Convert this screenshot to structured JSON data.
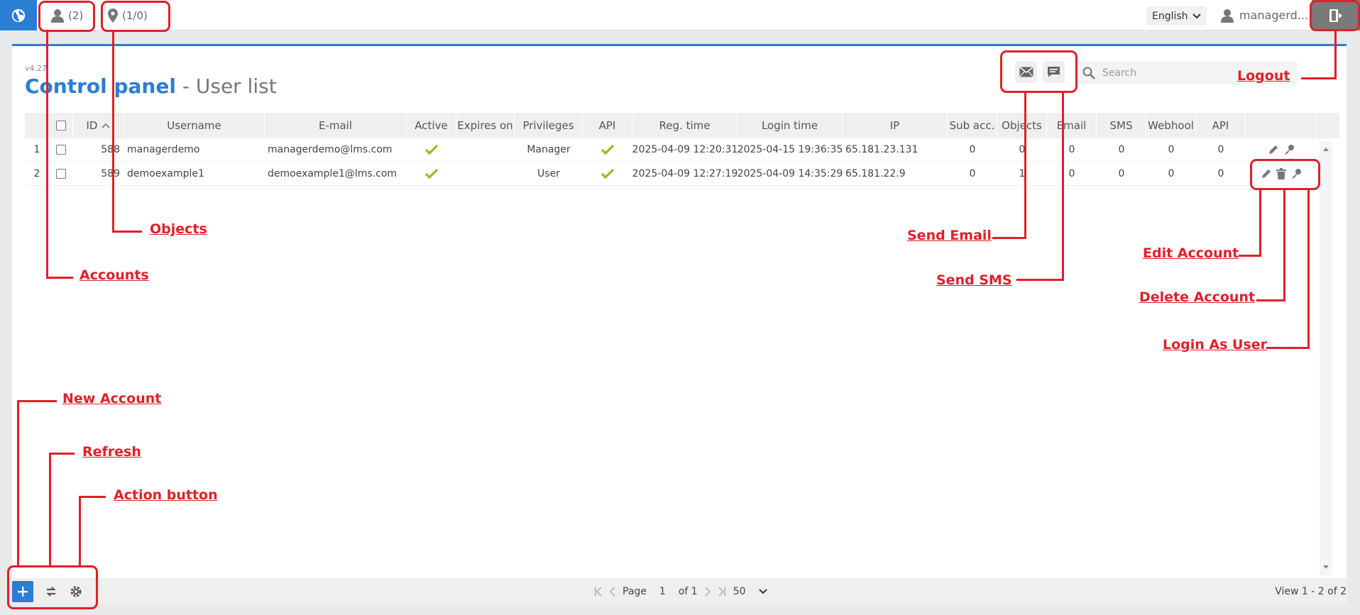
{
  "topbar": {
    "accounts_count": "(2)",
    "objects_count": "(1/0)",
    "language": "English",
    "user_name": "managerd..."
  },
  "panel": {
    "version": "v4.27",
    "title_main": "Control panel",
    "title_sub": " - User list",
    "search_placeholder": "Search"
  },
  "table": {
    "columns": [
      "ID",
      "Username",
      "E-mail",
      "Active",
      "Expires on",
      "Privileges",
      "API",
      "Reg. time",
      "Login time",
      "IP",
      "Sub acc.",
      "Objects",
      "Email",
      "SMS",
      "Webhool",
      "API"
    ],
    "rows": [
      {
        "num": "1",
        "id": "588",
        "username": "managerdemo",
        "email": "managerdemo@lms.com",
        "expires": "",
        "privileges": "Manager",
        "reg_time": "2025-04-09 12:20:31",
        "login_time": "2025-04-15 19:36:35",
        "ip": "65.181.23.131",
        "sub_acc": "0",
        "objects": "0",
        "email_cnt": "0",
        "sms": "0",
        "webhook": "0",
        "api_cnt": "0"
      },
      {
        "num": "2",
        "id": "589",
        "username": "demoexample1",
        "email": "demoexample1@lms.com",
        "expires": "",
        "privileges": "User",
        "reg_time": "2025-04-09 12:27:19",
        "login_time": "2025-04-09 14:35:29",
        "ip": "65.181.22.9",
        "sub_acc": "0",
        "objects": "1",
        "email_cnt": "0",
        "sms": "0",
        "webhook": "0",
        "api_cnt": "0"
      }
    ]
  },
  "footer": {
    "page_label": "Page",
    "page_value": "1",
    "of_label": "of 1",
    "per_page": "50",
    "view_count": "View 1 - 2 of 2"
  },
  "annotations": {
    "objects": "Objects",
    "accounts": "Accounts",
    "send_email": "Send Email",
    "send_sms": "Send SMS",
    "edit_account": "Edit Account",
    "delete_account": "Delete Account",
    "login_as_user": "Login As User",
    "new_account": "New Account",
    "refresh": "Refresh",
    "action_button": "Action button",
    "logout": "Logout"
  },
  "colors": {
    "accent": "#2b7ed1",
    "annotation": "#e0202a",
    "check": "#8dc21f"
  }
}
